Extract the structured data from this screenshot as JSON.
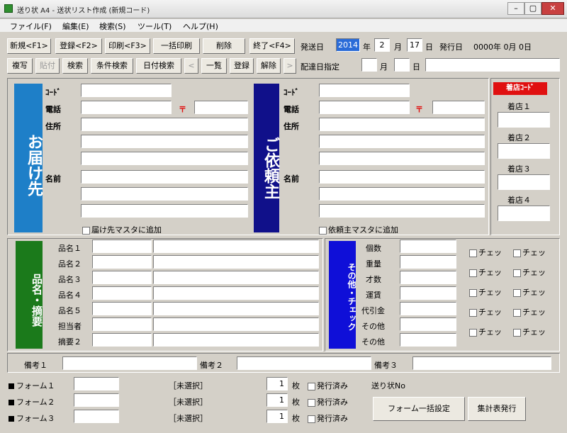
{
  "window": {
    "title": "送り状 A4 - 送状リスト作成 (新規コード)"
  },
  "menu": [
    "ファイル(F)",
    "編集(E)",
    "検索(S)",
    "ツール(T)",
    "ヘルプ(H)"
  ],
  "toolbar1": [
    "新規<F1>",
    "登録<F2>",
    "印刷<F3>",
    "一括印刷",
    "削除",
    "終了<F4>"
  ],
  "toolbar2": [
    "複写",
    "貼付",
    "検索",
    "条件検索",
    "日付検索",
    "<",
    "一覧",
    "登録",
    "解除",
    ">"
  ],
  "date": {
    "label": "発送日",
    "year": "2014",
    "year_unit": "年",
    "month": "2",
    "month_unit": "月",
    "day": "17",
    "day_unit": "日",
    "issue_label": "発行日",
    "issue_value": "0000年 0月 0日"
  },
  "delivery_date": {
    "label": "配達日指定",
    "month_unit": "月",
    "day_unit": "日"
  },
  "recipient": {
    "band": "お届け先",
    "code_label": "ｺｰﾄﾞ",
    "tel_label": "電話",
    "zip_mark": "〒",
    "addr_label": "住所",
    "name_label": "名前",
    "check_label": "届け先マスタに追加"
  },
  "sender": {
    "band": "ご依頼主",
    "code_label": "ｺｰﾄﾞ",
    "tel_label": "電話",
    "zip_mark": "〒",
    "addr_label": "住所",
    "name_label": "名前",
    "check_label": "依頼主マスタに追加"
  },
  "store": {
    "header": "着店ｺｰﾄﾞ",
    "items": [
      "着店１",
      "着店２",
      "着店３",
      "着店４"
    ]
  },
  "items": {
    "band": "品名・摘要",
    "labels": [
      "品名１",
      "品名２",
      "品名３",
      "品名４",
      "品名５",
      "担当者",
      "摘要２"
    ]
  },
  "other": {
    "band": "その他・チェック",
    "labels": [
      "個数",
      "重量",
      "才数",
      "運賃",
      "代引金",
      "その他",
      "その他"
    ],
    "check_text": "チェッ"
  },
  "notes": [
    "備考１",
    "備考２",
    "備考３"
  ],
  "forms": [
    {
      "label": "フォーム１",
      "status": "［未選択］",
      "count": "1",
      "unit": "枚",
      "issued": "発行済み"
    },
    {
      "label": "フォーム２",
      "status": "［未選択］",
      "count": "1",
      "unit": "枚",
      "issued": "発行済み"
    },
    {
      "label": "フォーム３",
      "status": "［未選択］",
      "count": "1",
      "unit": "枚",
      "issued": "発行済み"
    }
  ],
  "bottom": {
    "send_label": "送り状No",
    "form_setting_button": "フォーム一括設定",
    "tally_button": "集計表発行"
  },
  "colors": {
    "recipient_band": "#1e7fc8",
    "sender_band": "#10108a",
    "items_band": "#1b7a1b",
    "other_band": "#0f0fd8",
    "store_header": "#e01010",
    "title_bar": "#3a6ea5"
  }
}
